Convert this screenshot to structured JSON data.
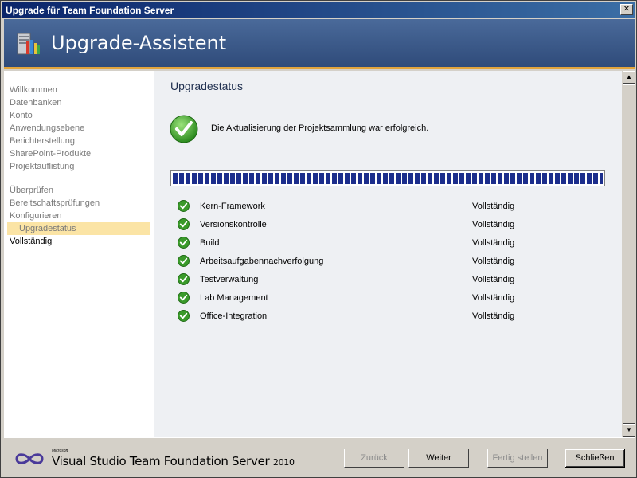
{
  "window": {
    "title": "Upgrade für Team Foundation Server",
    "close_glyph": "✕"
  },
  "header": {
    "title": "Upgrade-Assistent",
    "icon": "server-tools-icon"
  },
  "nav": {
    "items": [
      {
        "label": "Willkommen"
      },
      {
        "label": "Datenbanken"
      },
      {
        "label": "Konto"
      },
      {
        "label": "Anwendungsebene"
      },
      {
        "label": "Berichterstellung"
      },
      {
        "label": "SharePoint-Produkte"
      },
      {
        "label": "Projektauflistung"
      },
      {
        "label": "Überprüfen"
      },
      {
        "label": "Bereitschaftsprüfungen"
      },
      {
        "label": "Konfigurieren"
      },
      {
        "label": "Upgradestatus"
      },
      {
        "label": "Vollständig"
      }
    ],
    "selected": "Upgradestatus"
  },
  "main": {
    "title": "Upgradestatus",
    "message": "Die Aktualisierung der Projektsammlung war erfolgreich.",
    "progress_percent": 100,
    "steps": [
      {
        "name": "Kern-Framework",
        "status": "Vollständig"
      },
      {
        "name": "Versionskontrolle",
        "status": "Vollständig"
      },
      {
        "name": "Build",
        "status": "Vollständig"
      },
      {
        "name": "Arbeitsaufgabennachverfolgung",
        "status": "Vollständig"
      },
      {
        "name": "Testverwaltung",
        "status": "Vollständig"
      },
      {
        "name": "Lab Management",
        "status": "Vollständig"
      },
      {
        "name": "Office-Integration",
        "status": "Vollständig"
      }
    ]
  },
  "footer": {
    "logo_small": "Microsoft",
    "logo_text": "Visual Studio Team Foundation Server",
    "logo_year": "2010",
    "buttons": {
      "back": "Zurück",
      "next": "Weiter",
      "finish": "Fertig stellen",
      "close": "Schließen"
    }
  },
  "colors": {
    "accent": "#e2a43c",
    "header": "#2f4b7a",
    "selection": "#fbe4a5",
    "success": "#3a9a2a",
    "progress": "#1c2e8c"
  }
}
